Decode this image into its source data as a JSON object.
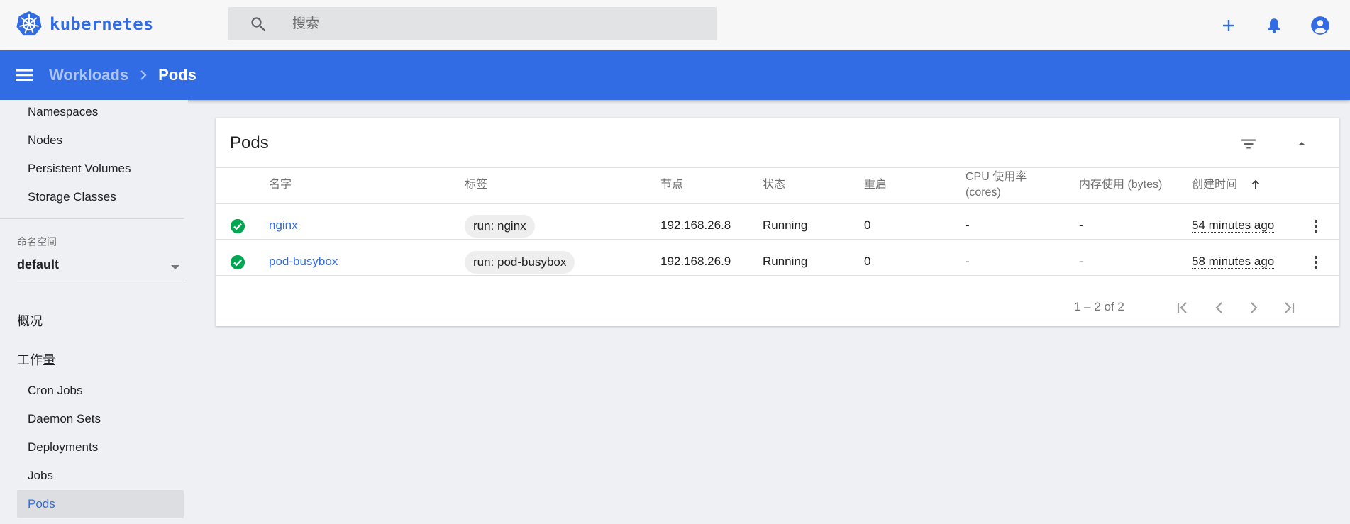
{
  "app": {
    "logo_text": "kubernetes"
  },
  "search": {
    "placeholder": "搜索"
  },
  "breadcrumb": {
    "parent": "Workloads",
    "current": "Pods"
  },
  "sidebar": {
    "cluster_items": [
      "Namespaces",
      "Nodes",
      "Persistent Volumes",
      "Storage Classes"
    ],
    "namespace_label": "命名空间",
    "namespace_value": "default",
    "overview": "概况",
    "workloads": "工作量",
    "workload_items": [
      "Cron Jobs",
      "Daemon Sets",
      "Deployments",
      "Jobs",
      "Pods"
    ],
    "active_item": "Pods"
  },
  "card": {
    "title": "Pods",
    "columns": [
      "名字",
      "标签",
      "节点",
      "状态",
      "重启",
      "CPU 使用率 (cores)",
      "内存使用 (bytes)",
      "创建时间"
    ],
    "rows": [
      {
        "status": "ok",
        "name": "nginx",
        "label": "run: nginx",
        "node": "192.168.26.8",
        "state": "Running",
        "restarts": "0",
        "cpu": "-",
        "memory": "-",
        "created": "54 minutes ago"
      },
      {
        "status": "ok",
        "name": "pod-busybox",
        "label": "run: pod-busybox",
        "node": "192.168.26.9",
        "state": "Running",
        "restarts": "0",
        "cpu": "-",
        "memory": "-",
        "created": "58 minutes ago"
      }
    ],
    "pagination": "1 – 2 of 2"
  },
  "colors": {
    "brand": "#326ce5",
    "status_ok": "#00a651"
  },
  "icons": [
    "kubernetes-logo-icon",
    "search-icon",
    "plus-icon",
    "bell-icon",
    "account-icon",
    "menu-icon",
    "chevron-right-icon",
    "filter-icon",
    "collapse-icon",
    "check-circle-icon",
    "sort-arrow-up-icon",
    "more-vert-icon",
    "first-page-icon",
    "prev-page-icon",
    "next-page-icon",
    "last-page-icon"
  ]
}
